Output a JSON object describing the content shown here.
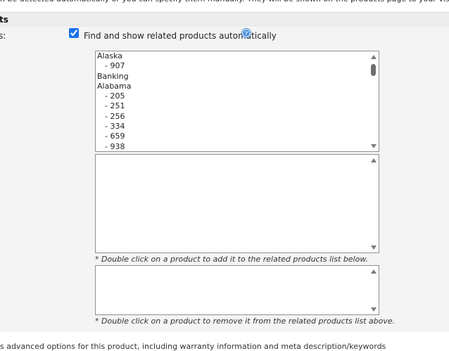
{
  "top_note": "n be detected automatically or you can specify them manually. They will be shown on the products page to your visitors.",
  "section_title": "ts",
  "field_label": "s:",
  "auto_checkbox": {
    "label": "Find and show related products automatically",
    "checked": true
  },
  "product_list": {
    "options": [
      {
        "label": "Alaska",
        "indent": false
      },
      {
        "label": "- 907",
        "indent": true
      },
      {
        "label": "Banking",
        "indent": false
      },
      {
        "label": "Alabama",
        "indent": false
      },
      {
        "label": "- 205",
        "indent": true
      },
      {
        "label": "- 251",
        "indent": true
      },
      {
        "label": "- 256",
        "indent": true
      },
      {
        "label": "- 334",
        "indent": true
      },
      {
        "label": "- 659",
        "indent": true
      },
      {
        "label": "- 938",
        "indent": true
      }
    ]
  },
  "hint_add": "* Double click on a product to add it to the related products list below.",
  "hint_remove": "* Double click on a product to remove it from the related products list above.",
  "bottom_note": "s advanced options for this product, including warranty information and meta description/keywords",
  "icons": {
    "help": "help-icon"
  },
  "colors": {
    "help_icon": "#4a90d9",
    "section_bg": "#ececec",
    "row_bg": "#f4f4f4"
  }
}
